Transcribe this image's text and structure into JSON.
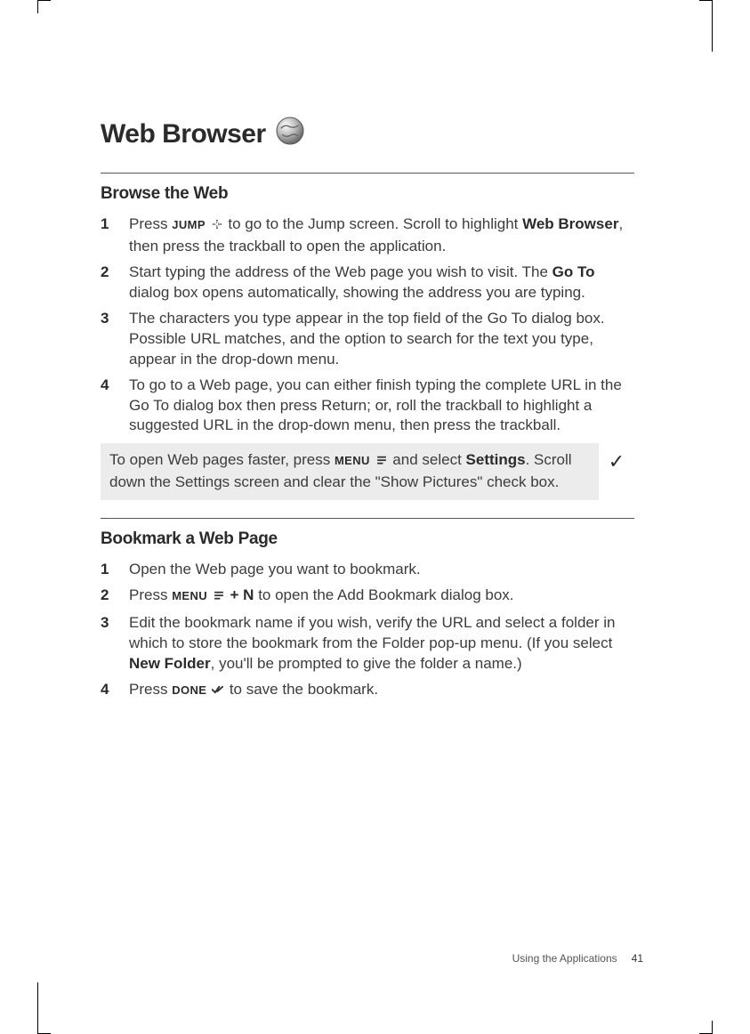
{
  "title": "Web Browser",
  "section1": {
    "heading": "Browse the Web",
    "steps": {
      "s1": {
        "num": "1",
        "textA": "Press ",
        "jump": "JUMP",
        "textB": " to go to the Jump screen. Scroll to highlight ",
        "bold": "Web Browser",
        "textC": ", then press the trackball to open the application."
      },
      "s2": {
        "num": "2",
        "textA": "Start typing the address of the Web page you wish to visit. The ",
        "bold": "Go To",
        "textB": " dialog box opens automatically, showing the address you are typing."
      },
      "s3": {
        "num": "3",
        "text": "The characters you type appear in the top field of the Go To dialog box. Possible URL matches, and the option to search for the text you type, appear in the drop-down menu."
      },
      "s4": {
        "num": "4",
        "text": "To go to a Web page, you can either finish typing the complete URL in the Go To dialog box then press Return; or, roll the trackball to highlight a suggested URL in the drop-down menu, then press the trackball."
      }
    },
    "tip": {
      "textA": "To open Web pages faster, press ",
      "menu": "MENU",
      "textB": " and select ",
      "bold": "Settings",
      "textC": ". Scroll down the Settings screen and clear the \"Show Pictures\" check box."
    }
  },
  "section2": {
    "heading": "Bookmark a Web Page",
    "steps": {
      "s1": {
        "num": "1",
        "text": "Open the Web page you want to bookmark."
      },
      "s2": {
        "num": "2",
        "textA": "Press ",
        "menu": "MENU",
        "plusN": " + N",
        "textB": " to open the Add Bookmark dialog box."
      },
      "s3": {
        "num": "3",
        "textA": "Edit the bookmark name if you wish, verify the URL and select a folder in which to store the bookmark from the Folder pop-up menu. (If you select ",
        "bold": "New Folder",
        "textB": ", you'll be prompted to give the folder a name.)"
      },
      "s4": {
        "num": "4",
        "textA": "Press ",
        "done": "DONE",
        "textB": " to save the bookmark."
      }
    }
  },
  "footer": {
    "section": "Using the Applications",
    "page": "41"
  }
}
